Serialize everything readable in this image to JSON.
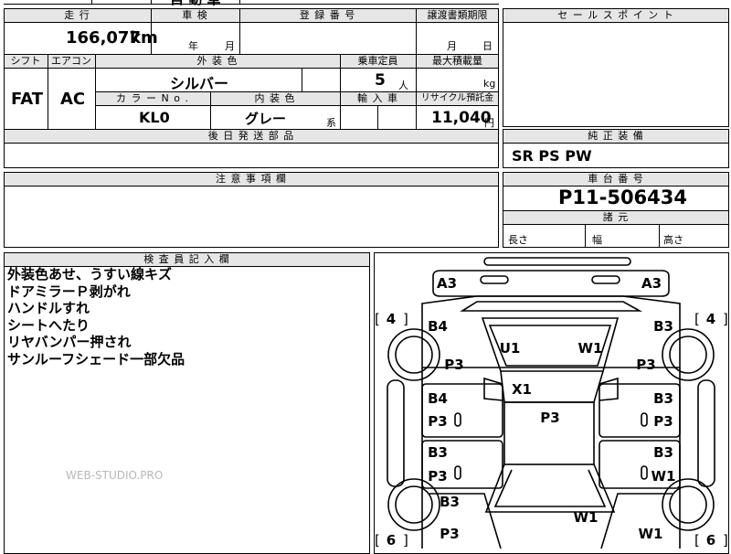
{
  "header": {
    "top_partial_title": "自 動 車",
    "mileage_label": "走 行",
    "mileage_value": "166,077",
    "mileage_unit": "km",
    "inspection_label": "車 検",
    "year_unit": "年",
    "month_unit": "月",
    "registration_label": "登 録 番 号",
    "transfer_label": "譲渡書類期限",
    "transfer_month": "月",
    "transfer_day": "日",
    "sales_point_label": "セ ー ル ス ポ イ ン ト"
  },
  "spec": {
    "shift_label": "シフト",
    "shift_value": "FAT",
    "aircon_label": "エアコン",
    "aircon_value": "AC",
    "exterior_label": "外 装 色",
    "exterior_value": "シルバー",
    "capacity_label": "乗車定員",
    "capacity_value": "5",
    "capacity_unit": "人",
    "max_load_label": "最大積載量",
    "max_load_unit": "kg",
    "color_no_label": "カ ラ ー N o .",
    "color_no_value": "KL0",
    "interior_label": "内 装 色",
    "interior_value": "グレー",
    "interior_suffix": "系",
    "import_label": "輸 入 車",
    "recycle_label": "リサイクル預託金",
    "recycle_value": "11,040",
    "recycle_unit": "円",
    "shipping_parts_label": "後 日 発 送 部 品"
  },
  "equipment": {
    "label": "純 正 装 備",
    "value": "SR PS PW"
  },
  "notes": {
    "label": "注 意 事 項 欄"
  },
  "chassis": {
    "label": "車 台 番 号",
    "value": "P11-506434",
    "dims_label": "諸 元",
    "length_label": "長さ",
    "width_label": "幅",
    "height_label": "高さ"
  },
  "inspector": {
    "label": "検 査 員 記 入 欄",
    "lines": [
      "外装色あせ、うすい線キズ",
      "ドアミラーＰ剥がれ",
      "ハンドルすれ",
      "シートへたり",
      "リヤバンパー押され",
      "サンルーフシェード一部欠品"
    ]
  },
  "watermark": "WEB-STUDIO.PRO",
  "diagram": {
    "tire_marks": [
      "4",
      "4",
      "6",
      "6"
    ],
    "labels": [
      "A3",
      "A3",
      "B4",
      "B3",
      "P3",
      "P3",
      "U1",
      "W1",
      "X1",
      "B4",
      "B3",
      "P3",
      "P3",
      "P3",
      "B3",
      "B3",
      "P3",
      "W1",
      "B3",
      "W1",
      "P3",
      "W1"
    ]
  }
}
